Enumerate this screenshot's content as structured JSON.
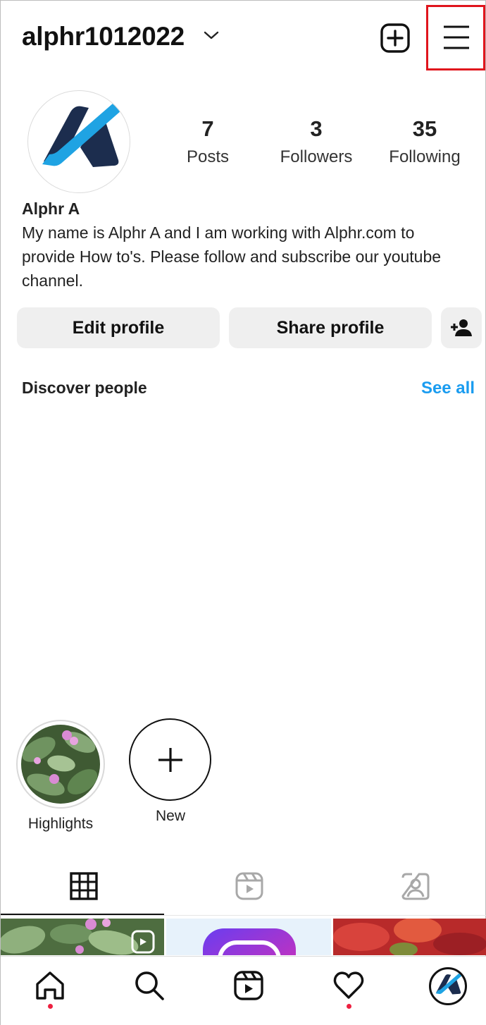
{
  "header": {
    "username": "alphr1012022"
  },
  "profile": {
    "stats": [
      {
        "value": "7",
        "label": "Posts"
      },
      {
        "value": "3",
        "label": "Followers"
      },
      {
        "value": "35",
        "label": "Following"
      }
    ],
    "name": "Alphr A",
    "bio": "My name is Alphr A and I am working with Alphr.com to provide How to's. Please follow and subscribe our youtube channel."
  },
  "actions": {
    "edit": "Edit profile",
    "share": "Share profile"
  },
  "discover": {
    "title": "Discover people",
    "see_all": "See all"
  },
  "highlights": [
    {
      "label": "Highlights"
    },
    {
      "label": "New"
    }
  ],
  "colors": {
    "accent": "#1a9cf0",
    "brand_dark": "#1c2d4e",
    "brand_light": "#1fa3e3",
    "highlight_box": "#e0141c",
    "notification": "#ed2040"
  },
  "icons": [
    "chevron-down-icon",
    "new-post-icon",
    "menu-icon",
    "add-person-icon",
    "plus-icon",
    "grid-icon",
    "reels-icon",
    "tagged-icon",
    "home-icon",
    "search-icon",
    "reels-icon",
    "heart-icon",
    "profile-avatar-icon"
  ]
}
